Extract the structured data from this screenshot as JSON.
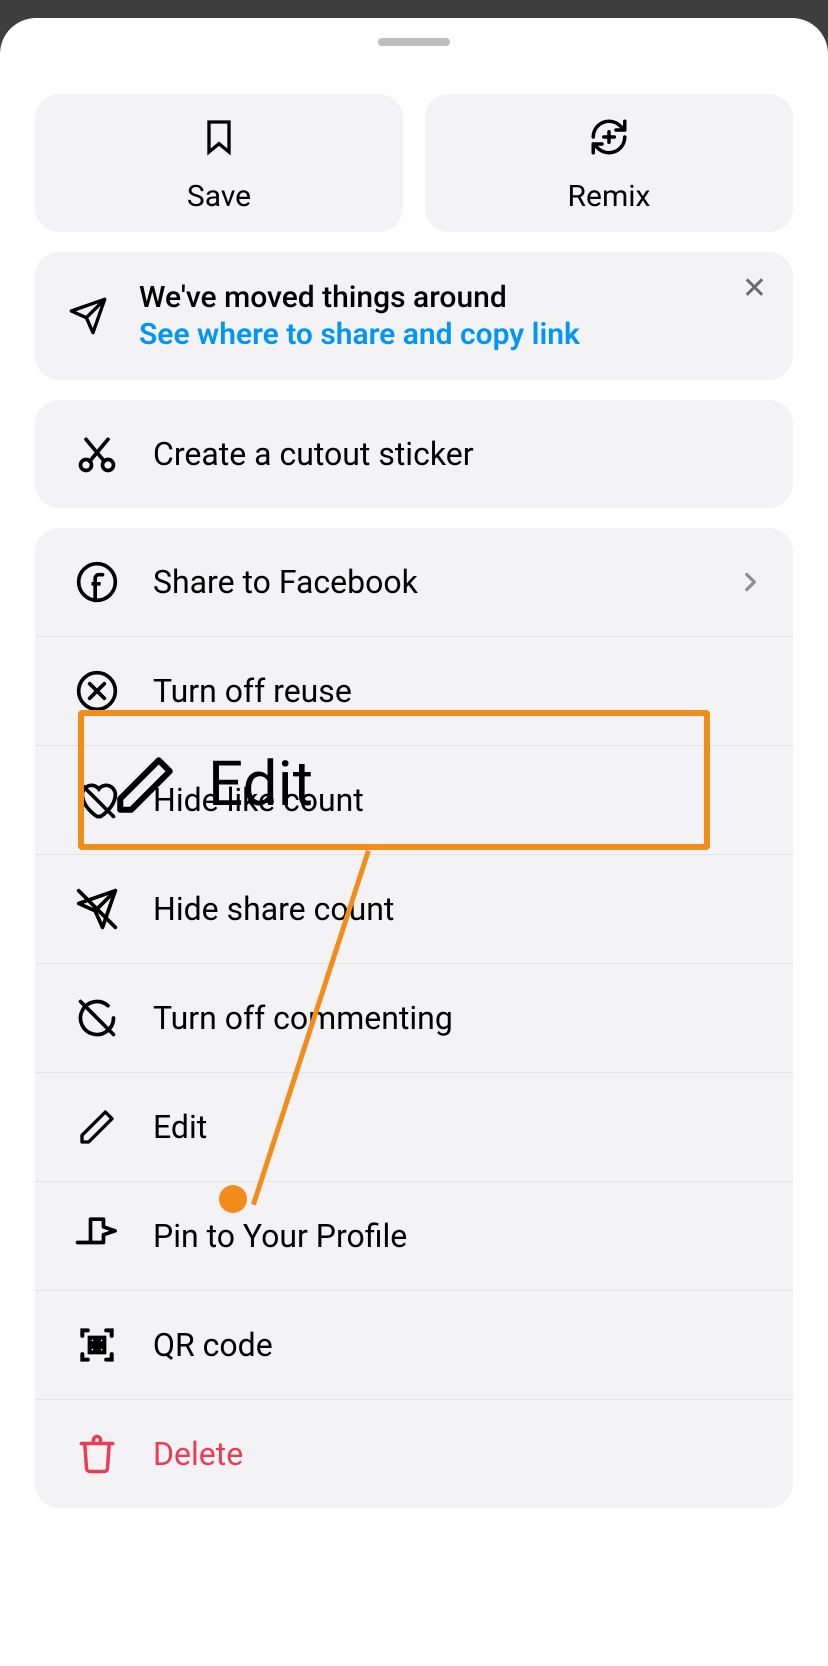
{
  "top": {
    "save_label": "Save",
    "remix_label": "Remix"
  },
  "info": {
    "title": "We've moved things around",
    "link": "See where to share and copy link"
  },
  "cutout": {
    "label": "Create a cutout sticker"
  },
  "menu": {
    "share_facebook": "Share to Facebook",
    "turn_off_reuse": "Turn off reuse",
    "hide_like_count": "Hide like count",
    "hide_share_count": "Hide share count",
    "turn_off_commenting": "Turn off commenting",
    "edit": "Edit",
    "pin": "Pin to Your Profile",
    "qr": "QR code",
    "delete": "Delete"
  },
  "callout": {
    "label": "Edit"
  },
  "colors": {
    "link": "#0195f7",
    "destructive": "#ec3b55",
    "annotation": "#f28c1b"
  }
}
